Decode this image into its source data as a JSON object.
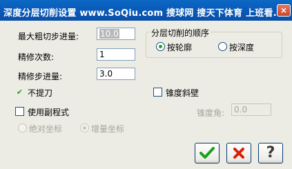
{
  "window": {
    "title": "深度分层切削设置    www.SoQiu.com  搜球网 搜天下体育 上班看...",
    "close_glyph": "×"
  },
  "fields": {
    "max_rough_step": {
      "label": "最大粗切步进量:",
      "value": "10.0"
    },
    "finish_count": {
      "label": "精修次数:",
      "value": "1"
    },
    "finish_step": {
      "label": "精修步进量:",
      "value": "3.0"
    },
    "taper_angle": {
      "label": "锥度角:",
      "value": "0.0"
    }
  },
  "layer_order": {
    "legend": "分层切削的顺序",
    "options": [
      {
        "label": "按轮廓",
        "selected": true
      },
      {
        "label": "按深度",
        "selected": false
      }
    ]
  },
  "checkboxes": {
    "no_lift": {
      "label": "不提刀",
      "checked": true,
      "mark": "✔"
    },
    "use_subprogram": {
      "label": "使用副程式",
      "checked": false,
      "mark": ""
    },
    "taper_wall": {
      "label": "锥度斜壁",
      "checked": false,
      "mark": ""
    }
  },
  "coord_mode": {
    "options": [
      {
        "label": "绝对坐标",
        "selected": false
      },
      {
        "label": "增量坐标",
        "selected": true
      }
    ]
  },
  "buttons": {
    "ok": {
      "icon": "check-icon",
      "color": "#1aa01a"
    },
    "cancel": {
      "icon": "x-icon",
      "color": "#d81e05"
    },
    "help": {
      "icon": "question-icon",
      "glyph": "?"
    }
  }
}
